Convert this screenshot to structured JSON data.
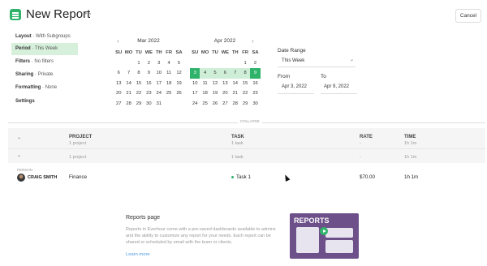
{
  "header": {
    "title": "New Report",
    "more": "···",
    "cancel_label": "Cancel"
  },
  "menu": [
    {
      "label": "Layout",
      "value": "With Subgroups",
      "active": false
    },
    {
      "label": "Period",
      "value": "This Week",
      "active": true
    },
    {
      "label": "Filters",
      "value": "No filters",
      "active": false
    },
    {
      "label": "Sharing",
      "value": "Private",
      "active": false
    },
    {
      "label": "Formatting",
      "value": "None",
      "active": false
    },
    {
      "label": "Settings",
      "value": "",
      "active": false
    }
  ],
  "calendars": {
    "prev_icon": "‹",
    "next_icon": "›",
    "weekdays": [
      "SU",
      "MO",
      "TU",
      "WE",
      "TH",
      "FR",
      "SA"
    ],
    "months": [
      {
        "title": "Mar 2022",
        "days": [
          "",
          "",
          "1",
          "2",
          "3",
          "4",
          "5",
          "6",
          "7",
          "8",
          "9",
          "10",
          "11",
          "12",
          "13",
          "14",
          "15",
          "16",
          "17",
          "18",
          "19",
          "20",
          "21",
          "22",
          "23",
          "24",
          "25",
          "26",
          "27",
          "28",
          "29",
          "30",
          "31",
          "",
          ""
        ]
      },
      {
        "title": "Apr 2022",
        "days": [
          "",
          "",
          "",
          "",
          "",
          "1",
          "2",
          "3",
          "4",
          "5",
          "6",
          "7",
          "8",
          "9",
          "10",
          "11",
          "12",
          "13",
          "14",
          "15",
          "16",
          "17",
          "18",
          "19",
          "20",
          "21",
          "22",
          "23",
          "24",
          "25",
          "26",
          "27",
          "28",
          "29",
          "30"
        ],
        "selected_start": "3",
        "selected_end": "9"
      }
    ]
  },
  "date_range": {
    "label": "Date Range",
    "value": "This Week",
    "caret": "⌄",
    "from_label": "From",
    "to_label": "To",
    "from_value": "Apr 3, 2022",
    "to_value": "Apr 9, 2022"
  },
  "table": {
    "toggle_label": "COLLAPSE",
    "headers": {
      "project": "PROJECT",
      "task": "TASK",
      "rate": "RATE",
      "time": "TIME"
    },
    "summary": {
      "project": "1 project",
      "task": "1 task",
      "rate": "-",
      "time": "1h 1m"
    },
    "group": {
      "project": "1 project",
      "task": "1 task",
      "rate": "-",
      "time": "1h 1m"
    },
    "group_label": "PERSON",
    "rows": [
      {
        "name": "CRAIG SMITH",
        "project": "Finance",
        "task": "Task 1",
        "rate": "$70.00",
        "time": "1h 1m"
      }
    ]
  },
  "promo": {
    "title": "Reports page",
    "text": "Reports in Everhour come with a pre-saved dashboards available to admins and the ability to customize any report for your needs. Each report can be shared or scheduled by email with the team or clients.",
    "link": "Learn more",
    "image_title": "REPORTS"
  },
  "colors": {
    "accent": "#2fb36b",
    "active_bg": "#d7f0dc",
    "range_bg": "#cfeed7",
    "promo_bg": "#6d4f89",
    "link": "#4a9be0"
  }
}
